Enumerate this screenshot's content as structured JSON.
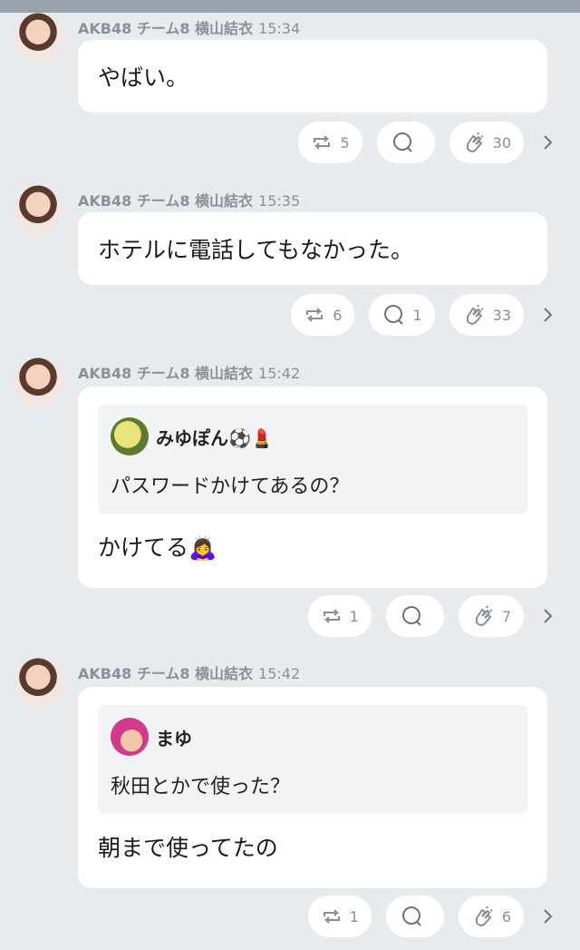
{
  "posts": [
    {
      "author": "AKB48 チーム8 横山結衣",
      "time": "15:34",
      "message": "やばい。",
      "quote": null,
      "repost_count": "5",
      "comment_count": "",
      "clap_count": "30"
    },
    {
      "author": "AKB48 チーム8 横山結衣",
      "time": "15:35",
      "message": "ホテルに電話してもなかった。",
      "quote": null,
      "repost_count": "6",
      "comment_count": "1",
      "clap_count": "33"
    },
    {
      "author": "AKB48 チーム8 横山結衣",
      "time": "15:42",
      "message": "かけてる🙇‍♀️",
      "quote": {
        "user": "みゆぽん⚽💄",
        "text": "パスワードかけてあるの？"
      },
      "repost_count": "1",
      "comment_count": "",
      "clap_count": "7"
    },
    {
      "author": "AKB48 チーム8 横山結衣",
      "time": "15:42",
      "message": "朝まで使ってたの",
      "quote": {
        "user": "まゆ",
        "text": "秋田とかで使った？"
      },
      "repost_count": "1",
      "comment_count": "",
      "clap_count": "6"
    }
  ],
  "icons": {
    "repost": "repost-icon",
    "comment": "comment-icon",
    "clap": "clap-icon",
    "more": "chevron-right-icon"
  }
}
